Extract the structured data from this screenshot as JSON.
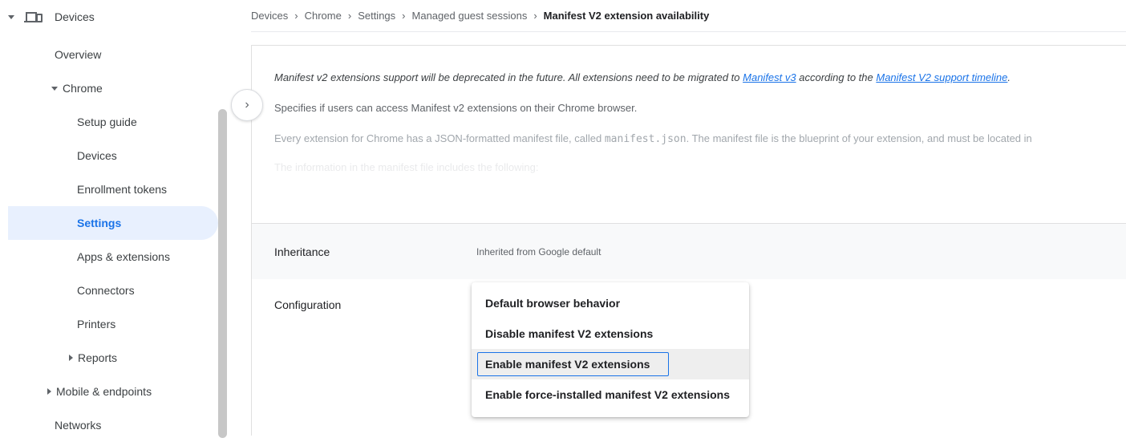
{
  "sidebar": {
    "items": [
      {
        "label": "Devices",
        "level": 0,
        "caret": "down",
        "icon": "devices-icon"
      },
      {
        "label": "Overview",
        "level": 1
      },
      {
        "label": "Chrome",
        "level": 1,
        "caret": "down"
      },
      {
        "label": "Setup guide",
        "level": 2
      },
      {
        "label": "Devices",
        "level": 2
      },
      {
        "label": "Enrollment tokens",
        "level": 2
      },
      {
        "label": "Settings",
        "level": 2,
        "active": true
      },
      {
        "label": "Apps & extensions",
        "level": 2
      },
      {
        "label": "Connectors",
        "level": 2
      },
      {
        "label": "Printers",
        "level": 2
      },
      {
        "label": "Reports",
        "level": 2,
        "caret": "right"
      },
      {
        "label": "Mobile & endpoints",
        "level": 1,
        "caret": "right"
      },
      {
        "label": "Networks",
        "level": 1
      }
    ]
  },
  "breadcrumb": {
    "items": [
      "Devices",
      "Chrome",
      "Settings",
      "Managed guest sessions"
    ],
    "current": "Manifest V2 extension availability",
    "separator": "›"
  },
  "description": {
    "notice_prefix": "Manifest v2 extensions support will be deprecated in the future. All extensions need to be migrated to ",
    "notice_link1": "Manifest v3",
    "notice_middle": " according to the ",
    "notice_link2": "Manifest V2 support timeline",
    "notice_suffix": ".",
    "line2": "Specifies if users can access Manifest v2 extensions on their Chrome browser.",
    "line3_prefix": "Every extension for Chrome has a JSON-formatted manifest file, called ",
    "line3_code": "manifest.json",
    "line3_suffix": ". The manifest file is the blueprint of your extension, and must be located in",
    "line4": "The information in the manifest file includes the following:"
  },
  "inheritance": {
    "label": "Inheritance",
    "value": "Inherited from Google default"
  },
  "configuration": {
    "label": "Configuration",
    "options": [
      "Default browser behavior",
      "Disable manifest V2 extensions",
      "Enable manifest V2 extensions",
      "Enable force-installed manifest V2 extensions"
    ],
    "highlighted_index": 2
  },
  "collapse_button": {
    "glyph": "›"
  },
  "colors": {
    "accent": "#1a73e8",
    "active_bg": "#e8f0fe",
    "row_bg": "#f8f9fa"
  }
}
